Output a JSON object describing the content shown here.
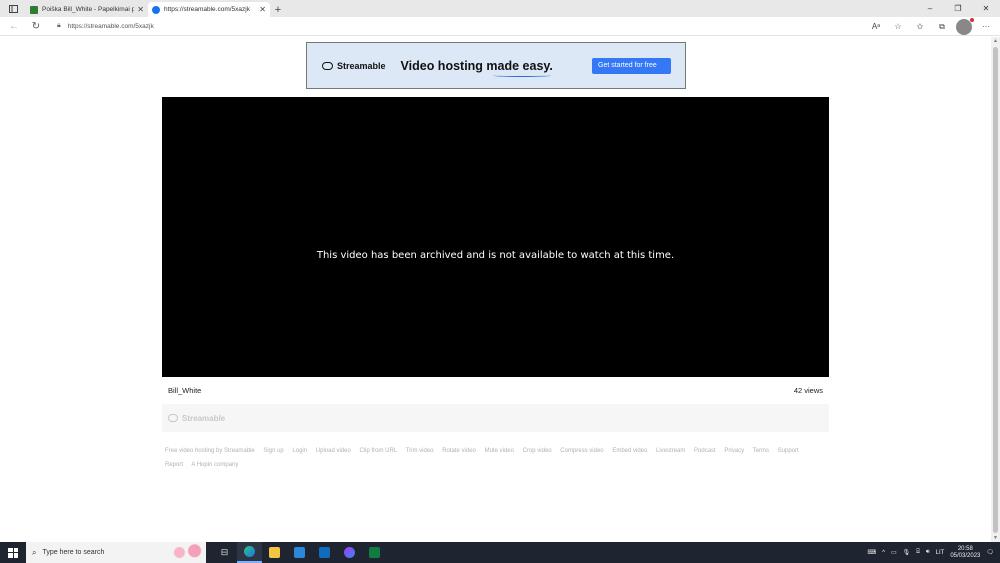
{
  "browser": {
    "tabs": [
      {
        "title": "Poiška Bill_White - Papelkimai pr...",
        "favicon_color": "#2e7d32"
      },
      {
        "title": "https://streamable.com/5xazjk",
        "favicon_color": "#1a73e8"
      }
    ],
    "url": "https://streamable.com/5xazjk",
    "window_controls": {
      "minimize": "–",
      "restore": "❐",
      "close": "✕"
    },
    "new_tab": "+"
  },
  "ad": {
    "brand": "Streamable",
    "headline": "Video hosting made easy.",
    "cta": "Get started for free"
  },
  "player": {
    "message": "This video has been archived and is not available to watch at this time."
  },
  "video_info": {
    "uploader": "Bill_White",
    "views": "42 views"
  },
  "footer": {
    "brand": "Streamable",
    "links": [
      "Free video hosting by Streamable",
      "Sign up",
      "Login",
      "Upload video",
      "Clip from URL",
      "Trim video",
      "Rotate video",
      "Mute video",
      "Crop video",
      "Compress video",
      "Embed video",
      "Livestream",
      "Podcast",
      "Privacy",
      "Terms",
      "Support",
      "Report",
      "A Hopin company"
    ]
  },
  "taskbar": {
    "search_placeholder": "Type here to search",
    "language": "LIT",
    "time": "20:58",
    "date": "05/03/2023"
  },
  "colors": {
    "accent": "#3478f6",
    "ad_bg": "#dde8f7",
    "taskbar_bg": "#1f2530"
  }
}
